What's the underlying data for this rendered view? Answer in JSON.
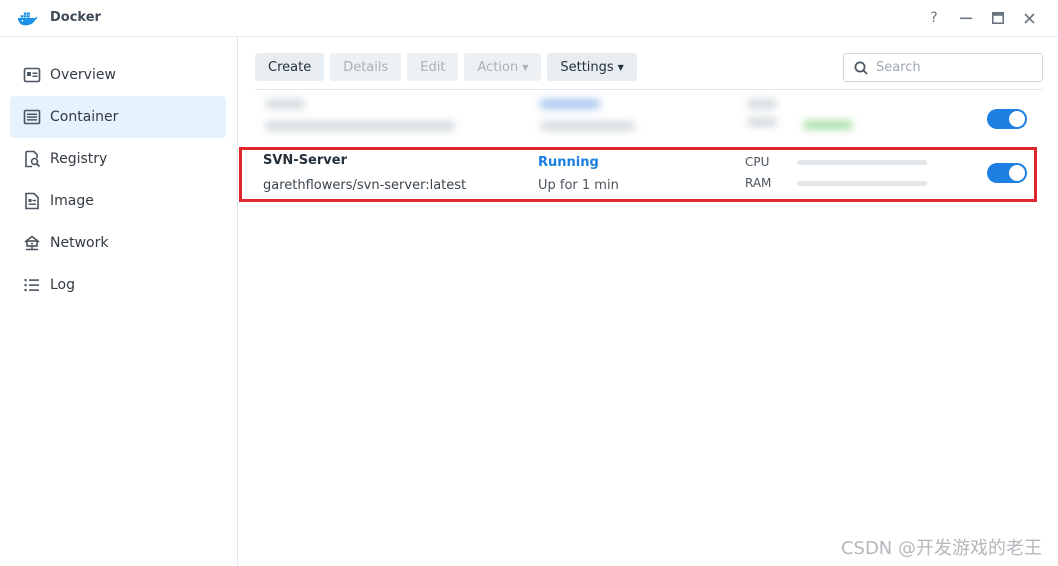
{
  "app": {
    "title": "Docker",
    "brand_color": "#1e7fe3"
  },
  "window_controls": {
    "help": "?",
    "minimize": "—",
    "maximize": "▣",
    "close": "✕"
  },
  "sidebar": {
    "items": [
      {
        "label": "Overview",
        "icon": "overview-icon",
        "active": false
      },
      {
        "label": "Container",
        "icon": "container-icon",
        "active": true
      },
      {
        "label": "Registry",
        "icon": "registry-icon",
        "active": false
      },
      {
        "label": "Image",
        "icon": "image-icon",
        "active": false
      },
      {
        "label": "Network",
        "icon": "network-icon",
        "active": false
      },
      {
        "label": "Log",
        "icon": "log-icon",
        "active": false
      }
    ]
  },
  "toolbar": {
    "create": "Create",
    "details": "Details",
    "edit": "Edit",
    "action": "Action",
    "settings": "Settings"
  },
  "search": {
    "placeholder": "Search",
    "value": ""
  },
  "containers": [
    {
      "name": "SVN-Server",
      "image": "garethflowers/svn-server:latest",
      "status": "Running",
      "uptime": "Up for 1 min",
      "cpu_label": "CPU",
      "ram_label": "RAM",
      "cpu_usage": 0,
      "ram_usage": 0,
      "enabled": true
    }
  ],
  "watermark": "CSDN @开发游戏的老王",
  "colors": {
    "highlight_border": "#e0262f",
    "status_running": "#1a7fe0",
    "toggle_on": "#1e7fe3"
  }
}
